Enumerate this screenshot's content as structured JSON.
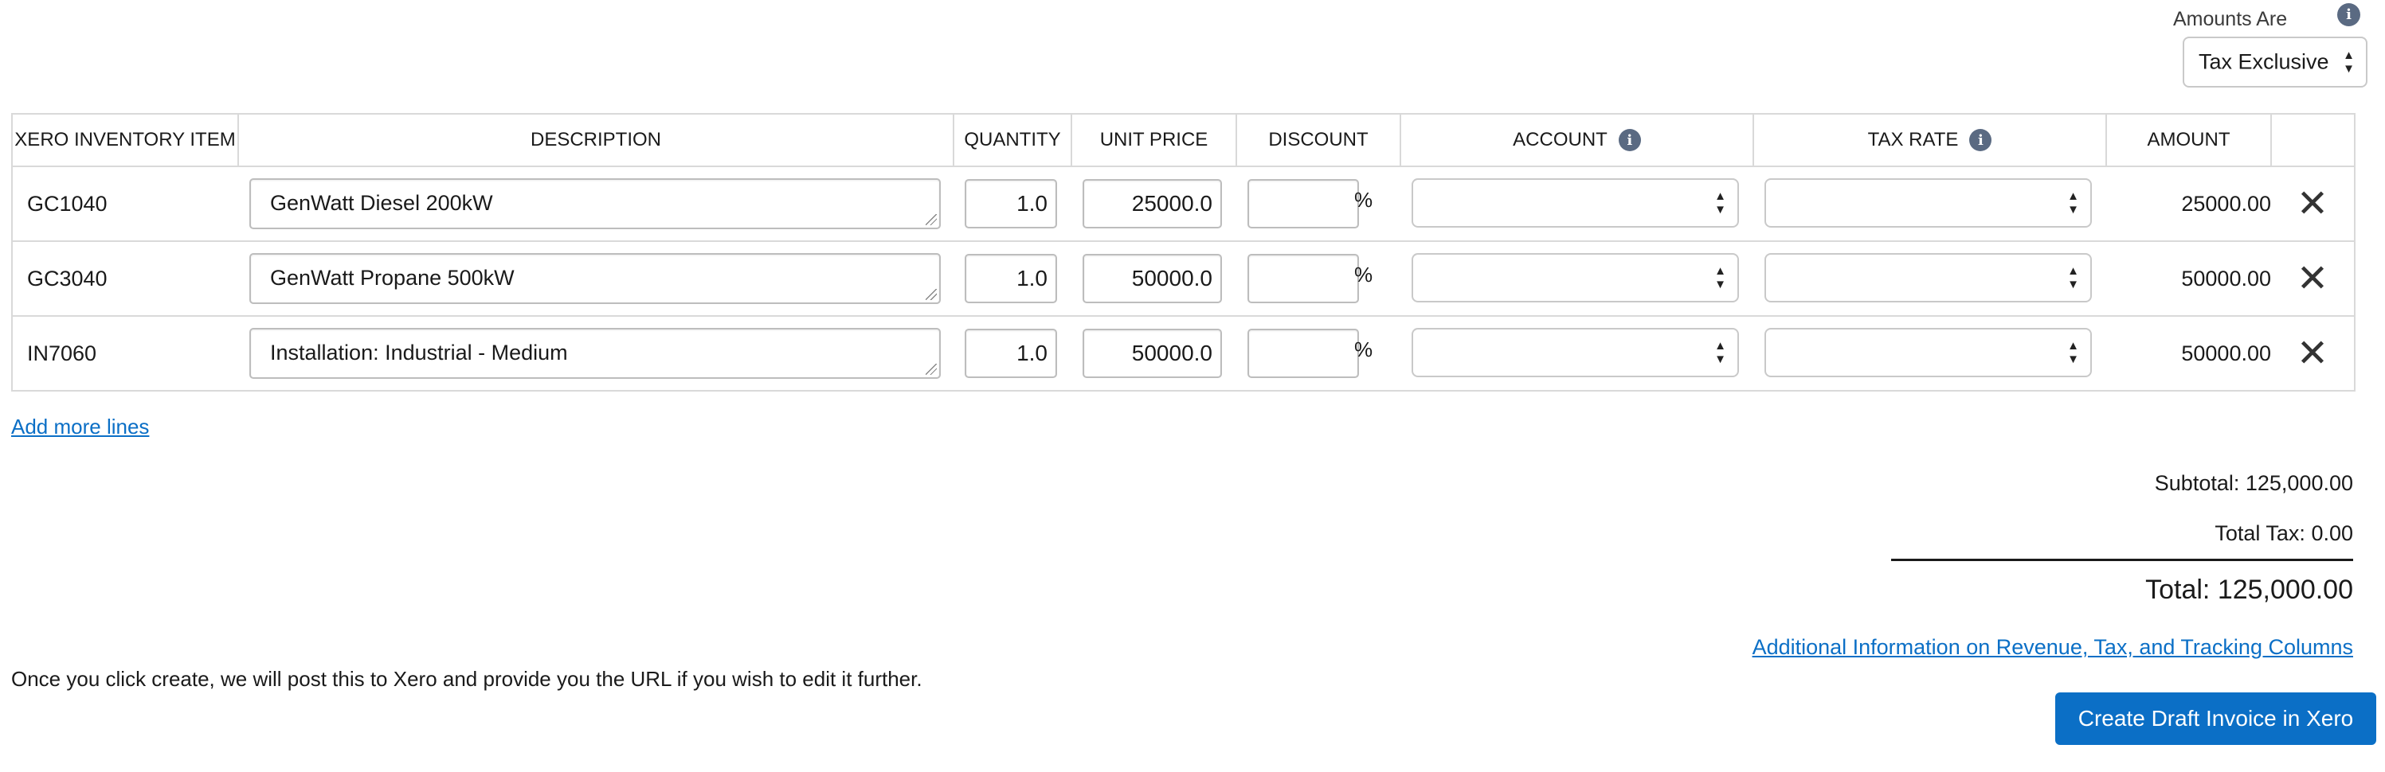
{
  "amounts_are": {
    "label": "Amounts Are",
    "selected": "Tax Exclusive"
  },
  "table": {
    "headers": {
      "item": "XERO INVENTORY ITEM",
      "description": "DESCRIPTION",
      "quantity": "QUANTITY",
      "unit_price": "UNIT PRICE",
      "discount": "DISCOUNT",
      "account": "ACCOUNT",
      "tax_rate": "TAX RATE",
      "amount": "AMOUNT"
    },
    "rows": [
      {
        "item": "GC1040",
        "description": "GenWatt Diesel 200kW",
        "quantity": "1.0",
        "unit_price": "25000.0",
        "discount": "",
        "discount_suffix": "%",
        "account": "",
        "tax_rate": "",
        "amount": "25000.00"
      },
      {
        "item": "GC3040",
        "description": "GenWatt Propane 500kW",
        "quantity": "1.0",
        "unit_price": "50000.0",
        "discount": "",
        "discount_suffix": "%",
        "account": "",
        "tax_rate": "",
        "amount": "50000.00"
      },
      {
        "item": "IN7060",
        "description": "Installation: Industrial - Medium",
        "quantity": "1.0",
        "unit_price": "50000.0",
        "discount": "",
        "discount_suffix": "%",
        "account": "",
        "tax_rate": "",
        "amount": "50000.00"
      }
    ]
  },
  "add_more_lines": "Add more lines",
  "totals": {
    "subtotal": "Subtotal: 125,000.00",
    "total_tax": "Total Tax: 0.00",
    "total": "Total: 125,000.00"
  },
  "additional_info_link": "Additional Information on Revenue, Tax, and Tracking Columns",
  "note": "Once you click create, we will post this to Xero and provide you the URL if you wish to edit it further.",
  "create_button": "Create Draft Invoice in Xero",
  "colors": {
    "primary": "#0b6fc6",
    "info_icon": "#5a6a82",
    "border": "#d9d9d9"
  }
}
